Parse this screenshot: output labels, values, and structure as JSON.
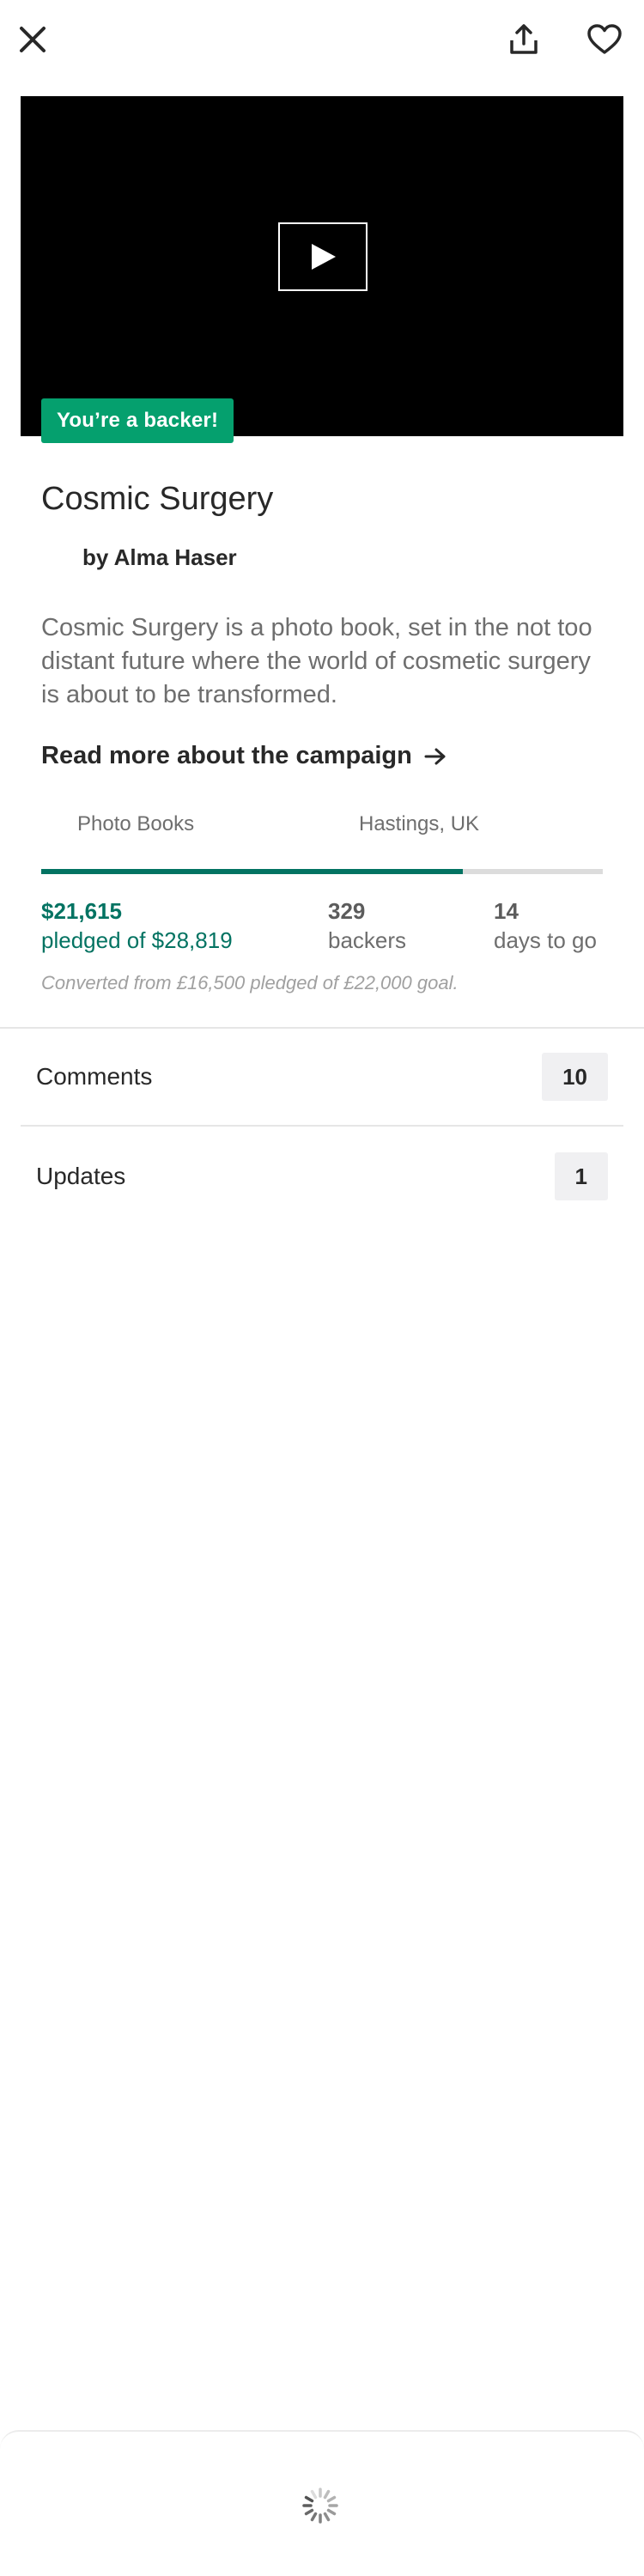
{
  "nav": {
    "close_icon": "close-icon",
    "share_icon": "share-icon",
    "save_icon": "heart-icon"
  },
  "video": {
    "play_icon": "play-icon",
    "badge": "You’re a backer!"
  },
  "project": {
    "title": "Cosmic Surgery",
    "creator": "by Alma Haser",
    "description": "Cosmic Surgery is a photo book, set in the not too distant future where the world of cosmetic surgery is about to be transformed.",
    "read_more": "Read more about the campaign",
    "category": "Photo Books",
    "location": "Hastings, UK"
  },
  "funding": {
    "progress_fraction": 0.75,
    "pledged": "$21,615",
    "goal_text": "pledged of $28,819",
    "backers_count": "329",
    "backers_label": "backers",
    "days_count": "14",
    "days_label": "days to go",
    "converted_note": "Converted from £16,500 pledged of £22,000 goal."
  },
  "sections": [
    {
      "label": "Comments",
      "count": "10"
    },
    {
      "label": "Updates",
      "count": "1"
    }
  ],
  "colors": {
    "accent_green": "#037362",
    "badge_green": "#05a06e"
  }
}
